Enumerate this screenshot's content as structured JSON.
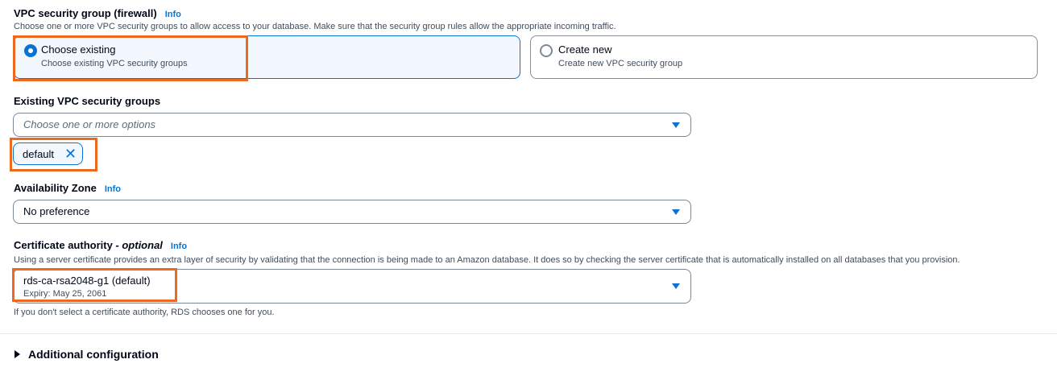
{
  "vpc_sg": {
    "label": "VPC security group (firewall)",
    "info": "Info",
    "description": "Choose one or more VPC security groups to allow access to your database. Make sure that the security group rules allow the appropriate incoming traffic.",
    "options": [
      {
        "title": "Choose existing",
        "subtitle": "Choose existing VPC security groups",
        "selected": true
      },
      {
        "title": "Create new",
        "subtitle": "Create new VPC security group",
        "selected": false
      }
    ]
  },
  "existing_sg": {
    "label": "Existing VPC security groups",
    "placeholder": "Choose one or more options",
    "tokens": [
      "default"
    ]
  },
  "az": {
    "label": "Availability Zone",
    "info": "Info",
    "value": "No preference"
  },
  "ca": {
    "label": "Certificate authority - ",
    "label_optional": "optional",
    "info": "Info",
    "description": "Using a server certificate provides an extra layer of security by validating that the connection is being made to an Amazon database. It does so by checking the server certificate that is automatically installed on all databases that you provision.",
    "value": "rds-ca-rsa2048-g1 (default)",
    "value_sub": "Expiry: May 25, 2061",
    "hint": "If you don't select a certificate authority, RDS chooses one for you."
  },
  "additional": {
    "label": "Additional configuration"
  },
  "colors": {
    "accent": "#0972d3",
    "highlight": "#ec6a1f"
  },
  "icons": {
    "dropdown": "caret-down-icon",
    "remove": "close-icon",
    "expand": "caret-right-icon"
  }
}
